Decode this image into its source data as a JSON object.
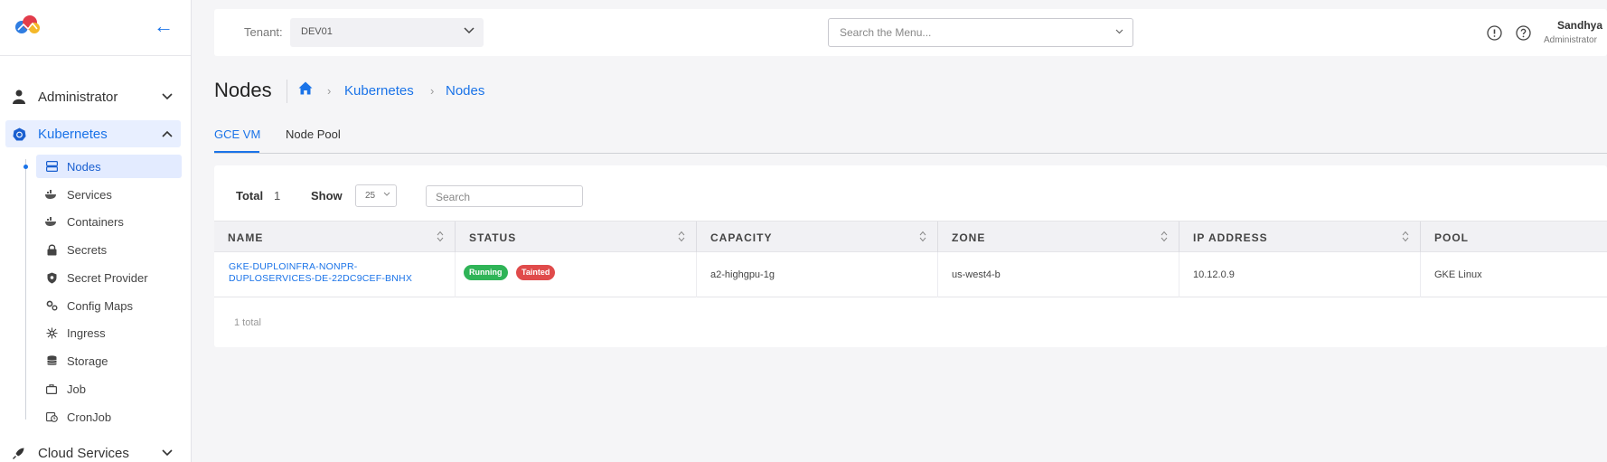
{
  "sidebar": {
    "sections": [
      {
        "label": "Administrator",
        "icon": "user-icon"
      },
      {
        "label": "Kubernetes",
        "icon": "kubernetes-icon"
      },
      {
        "label": "Cloud Services",
        "icon": "rocket-icon"
      }
    ],
    "sub_items": [
      {
        "label": "Nodes",
        "icon": "server-icon"
      },
      {
        "label": "Services",
        "icon": "docker-icon"
      },
      {
        "label": "Containers",
        "icon": "docker-icon"
      },
      {
        "label": "Secrets",
        "icon": "lock-icon"
      },
      {
        "label": "Secret Provider",
        "icon": "shield-icon"
      },
      {
        "label": "Config Maps",
        "icon": "gears-icon"
      },
      {
        "label": "Ingress",
        "icon": "network-icon"
      },
      {
        "label": "Storage",
        "icon": "database-icon"
      },
      {
        "label": "Job",
        "icon": "briefcase-icon"
      },
      {
        "label": "CronJob",
        "icon": "calendar-clock-icon"
      }
    ]
  },
  "topbar": {
    "tenant_label": "Tenant:",
    "tenant_value": "DEV01",
    "menu_search_placeholder": "Search the Menu...",
    "user_name": "Sandhya",
    "user_role": "Administrator"
  },
  "page": {
    "title": "Nodes",
    "breadcrumb": [
      "Kubernetes",
      "Nodes"
    ]
  },
  "tabs": [
    "GCE VM",
    "Node Pool"
  ],
  "table": {
    "total_label": "Total",
    "total_value": "1",
    "show_label": "Show",
    "page_size": "25",
    "search_placeholder": "Search",
    "columns": [
      "NAME",
      "STATUS",
      "CAPACITY",
      "ZONE",
      "IP ADDRESS",
      "POOL"
    ],
    "rows": [
      {
        "name": "GKE-DUPLOINFRA-NONPR-DUPLOSERVICES-DE-22DC9CEF-BNHX",
        "status": [
          "Running",
          "Tainted"
        ],
        "capacity": "a2-highgpu-1g",
        "zone": "us-west4-b",
        "ip": "10.12.0.9",
        "pool": "GKE Linux"
      }
    ],
    "footer": "1 total"
  },
  "colors": {
    "accent": "#1a73e8",
    "running": "#2fb457",
    "tainted": "#e04b4b"
  }
}
